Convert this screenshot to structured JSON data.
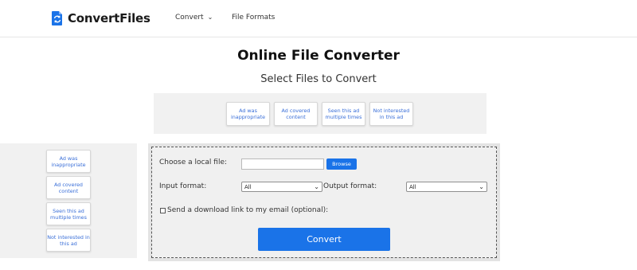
{
  "header": {
    "logo_text": "ConvertFiles",
    "nav": [
      {
        "label": "Convert",
        "has_dropdown": true
      },
      {
        "label": "File Formats",
        "has_dropdown": false
      }
    ]
  },
  "main": {
    "title": "Online File Converter",
    "subtitle": "Select Files to Convert"
  },
  "ad_feedback_top": [
    "Ad was inappropriate",
    "Ad covered content",
    "Seen this ad multiple times",
    "Not interested in this ad"
  ],
  "ad_feedback_left": [
    "Ad was inappropriate",
    "Ad covered content",
    "Seen this ad multiple times",
    "Not interested in this ad"
  ],
  "form": {
    "choose_label": "Choose a local file:",
    "browse_label": "Browse",
    "input_format_label": "Input format:",
    "input_format_value": "All",
    "output_format_label": "Output format:",
    "output_format_value": "All",
    "email_label": "Send a download link to my email (optional):",
    "email_checked": false,
    "convert_label": "Convert"
  },
  "colors": {
    "accent": "#1a73e8",
    "ad_text": "#3a6fd8",
    "ad_bg": "#f1f1f1",
    "panel_bg": "#f0f0f0"
  },
  "icons": {
    "logo": "file-convert-icon",
    "convert_chevron": "chevron-down-icon",
    "select_arrow": "chevron-down-icon"
  }
}
